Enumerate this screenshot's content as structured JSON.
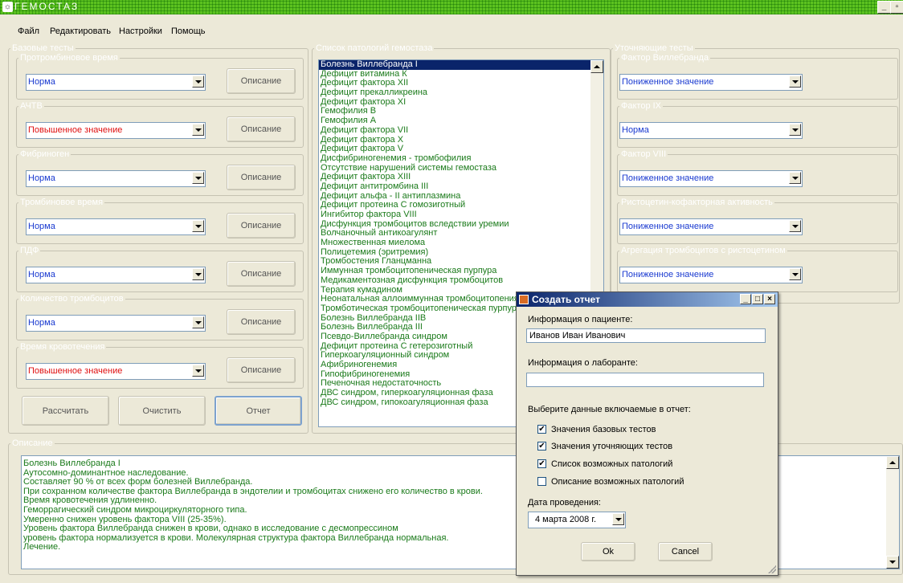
{
  "app": {
    "title": "ГЕМОСТАЗ"
  },
  "menu": [
    "Файл",
    "Редактировать",
    "Настройки",
    "Помощь"
  ],
  "base_tests": {
    "legend": "Базовые тесты",
    "describe_label": "Описание",
    "items": [
      {
        "label": "Протромбиновое время",
        "value": "Норма"
      },
      {
        "label": "АЧТВ",
        "value": "Повышенное значение"
      },
      {
        "label": "Фибриноген",
        "value": "Норма"
      },
      {
        "label": "Тромбиновое время",
        "value": "Норма"
      },
      {
        "label": "ПДФ",
        "value": "Норма"
      },
      {
        "label": "Количество  тромбоцитов",
        "value": "Норма"
      },
      {
        "label": "Время кровотечения",
        "value": "Повышенное значение"
      }
    ],
    "calc_button": "Рассчитать",
    "clear_button": "Очистить",
    "report_button": "Отчет"
  },
  "pathology_list": {
    "legend": "Список патологий гемостаза",
    "items": [
      "Болезнь Виллебранда I",
      "Дефицит витамина К",
      "Дефицит фактора XII",
      "Дефицит прекалликреина",
      "Дефицит фактора XI",
      "Гемофилия В",
      "Гемофилия А",
      "Дефицит фактора VII",
      "Дефицит фактора X",
      "Дефицит фактора V",
      "Дисфибриногенемия - тромбофилия",
      "Отсутствие нарушений системы гемостаза",
      "Дефицит фактора XIII",
      "Дефицит антитромбина III",
      "Дефицит альфа - II антиплазмина",
      "Дефицит протеина С гомозиготный",
      "Ингибитор фактора VIII",
      "Дисфункция тромбоцитов вследствии уремии",
      "Волчаночный антикоагулянт",
      "Множественная миелома",
      "Полицетемия (эритремия)",
      "Тромбостения Гланцманна",
      "Иммунная тромбоцитопеническая пурпура",
      "Медикаментозная дисфункция тромбоцитов",
      "Терапия кумадином",
      "Неонатальная аллоиммунная тромбоцитопения",
      "Тромботическая тромбоцитопеническая пурпура",
      "Болезнь Виллебранда IIB",
      "Болезнь Виллебранда III",
      "Псевдо-Виллебранда синдром",
      "Дефицит протеина С гетерозиготный",
      "Гиперкоагуляционный синдром",
      "Афибриногенемия",
      "Гипофибриногенемия",
      "Печеночная недостаточность",
      "ДВС синдром, гиперкоагуляционная фаза",
      "ДВС синдром, гипокоагуляционная фаза"
    ]
  },
  "refine_tests": {
    "legend": "Уточняющие тесты",
    "items": [
      {
        "label": "Фактор Виллебранда",
        "value": "Пониженное значение"
      },
      {
        "label": "Фактор IX",
        "value": "Норма"
      },
      {
        "label": "Фактор VIII",
        "value": "Пониженное значение"
      },
      {
        "label": "Ристоцетин-кофакторная активность",
        "value": "Пониженное значение"
      },
      {
        "label": "Агрегация тромбоцитов с ристоцетином",
        "value": "Пониженное значение"
      }
    ]
  },
  "description": {
    "legend": "Описание",
    "lines": [
      "Болезнь Виллебранда I",
      "Аутосомно-доминантное наследование.",
      "Составляет 90 % от всех форм болезней Виллебранда.",
      "При сохранном количестве фактора Виллебранда в эндотелии и тромбоцитах снижено его количество в крови.",
      "Время кровотечения удлиненно.",
      "Геморрагический синдром микроциркуляторного типа.",
      "Умеренно снижен уровень фактора VIII (25-35%).",
      "Уровень фактора Виллебранда снижен в крови, однако в исследование с десмопрессином",
      "уровень фактора нормализуется в крови. Молекулярная структура фактора Виллебранда нормальная.",
      "Лечение."
    ]
  },
  "dialog": {
    "title": "Создать отчет",
    "patient_label": "Информация о пациенте:",
    "patient_value": "Иванов Иван Иванович",
    "lab_label": "Информация о лаборанте:",
    "lab_value": "",
    "select_label": "Выберите данные включаемые в отчет:",
    "options": [
      {
        "label": "Значения базовых тестов",
        "checked": true
      },
      {
        "label": "Значения уточняющих тестов",
        "checked": true
      },
      {
        "label": "Список возможных патологий",
        "checked": true
      },
      {
        "label": "Описание возможных патологий",
        "checked": false
      }
    ],
    "date_label": "Дата проведения:",
    "date_value": "4    марта    2008 г.",
    "ok_button": "Ok",
    "cancel_button": "Cancel"
  },
  "colors": {
    "normal": "#1a3ad0",
    "elevated": "#e01010",
    "reduced": "#1a3ad0",
    "list_text": "#1a7a1a",
    "selection": "#0a246a"
  }
}
